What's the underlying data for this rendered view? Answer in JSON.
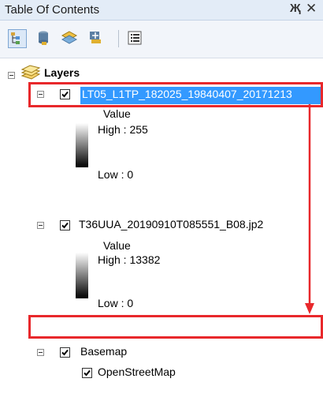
{
  "window": {
    "title": "Table Of Contents",
    "pin_glyph": "Җ",
    "close_glyph": "✕"
  },
  "toolbar": {
    "buttons": [
      {
        "icon": "list-by-drawing-order-icon",
        "active": true
      },
      {
        "icon": "list-by-source-icon",
        "active": false
      },
      {
        "icon": "list-by-visibility-icon",
        "active": false
      },
      {
        "icon": "list-by-selection-icon",
        "active": false
      },
      {
        "icon": "options-icon",
        "active": false
      }
    ]
  },
  "tree": {
    "root": {
      "label": "Layers"
    },
    "layers": [
      {
        "name": "LT05_L1TP_182025_19840407_20171213",
        "checked": true,
        "selected": true,
        "legend": {
          "field": "Value",
          "high": "High : 255",
          "low": "Low : 0"
        }
      },
      {
        "name": "T36UUA_20190910T085551_B08.jp2",
        "checked": true,
        "selected": false,
        "legend": {
          "field": "Value",
          "high": "High : 13382",
          "low": "Low : 0"
        }
      },
      {
        "name": "Basemap",
        "checked": true,
        "sublayers": [
          {
            "name": "OpenStreetMap",
            "checked": true
          }
        ]
      }
    ]
  },
  "colors": {
    "selection": "#3399ff",
    "highlight_annotation": "#e8282b"
  }
}
